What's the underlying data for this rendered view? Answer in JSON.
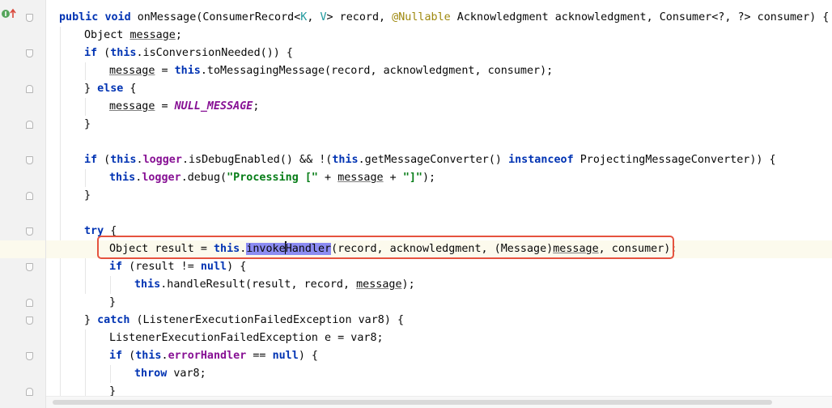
{
  "gutter": {
    "marker_icon": "implements-override-marker-icon"
  },
  "colors": {
    "keyword": "#0033b3",
    "string": "#067d17",
    "constant": "#871094",
    "annotation": "#9e880d",
    "generic": "#20999d",
    "selection": "#8c8cf2",
    "current_line": "#fcfaed",
    "callout_box": "#e5533f"
  },
  "code": {
    "l1": {
      "kw1": "public",
      "kw2": "void",
      "name": " onMessage(ConsumerRecord<",
      "k": "K",
      "comma": ", ",
      "v": "V",
      "rest1": "> record, ",
      "ann": "@Nullable",
      "rest2": " Acknowledgment acknowledgment, Consumer<?, ?> consumer) {"
    },
    "l2": {
      "t1": "Object ",
      "u": "message",
      "t2": ";"
    },
    "l3": {
      "kw": "if",
      "t1": " (",
      "this": "this",
      "t2": ".isConversionNeeded()) {"
    },
    "l4": {
      "u": "message",
      "t1": " = ",
      "this": "this",
      "t2": ".toMessagingMessage(record, acknowledgment, consumer);"
    },
    "l5": {
      "t1": "} ",
      "kw": "else",
      "t2": " {"
    },
    "l6": {
      "u": "message",
      "t1": " = ",
      "c": "NULL_MESSAGE",
      "t2": ";"
    },
    "l7": {
      "t1": "}"
    },
    "l8": {
      "kw": "if",
      "t1": " (",
      "this1": "this",
      "t2": ".",
      "f": "logger",
      "t3": ".isDebugEnabled() && !(",
      "this2": "this",
      "t4": ".getMessageConverter() ",
      "kw2": "instanceof",
      "t5": " ProjectingMessageConverter)) {"
    },
    "l9": {
      "this": "this",
      "t1": ".",
      "f": "logger",
      "t2": ".debug(",
      "s1": "\"Processing [\"",
      "t3": " + ",
      "u": "message",
      "t4": " + ",
      "s2": "\"]\"",
      "t5": ");"
    },
    "l10": {
      "t1": "}"
    },
    "l11": {
      "kw": "try",
      "t1": " {"
    },
    "l12": {
      "t1": "Object result = ",
      "this": "this",
      "t2": ".",
      "sel1": "invoke",
      "sel2": "Handler",
      "t3": "(record, acknowledgment, (Message)",
      "u": "message",
      "t4": ", consumer);"
    },
    "l13": {
      "kw": "if",
      "t1": " (result != ",
      "kw2": "null",
      "t2": ") {"
    },
    "l14": {
      "this": "this",
      "t1": ".handleResult(result, record, ",
      "u": "message",
      "t2": ");"
    },
    "l15": {
      "t1": "}"
    },
    "l16": {
      "t1": "} ",
      "kw": "catch",
      "t2": " (ListenerExecutionFailedException var8) {"
    },
    "l17": {
      "t1": "ListenerExecutionFailedException e = var8;"
    },
    "l18": {
      "kw": "if",
      "t1": " (",
      "this": "this",
      "t2": ".",
      "f": "errorHandler",
      "t3": " == ",
      "kw2": "null",
      "t4": ") {"
    },
    "l19": {
      "kw": "throw",
      "t1": " var8;"
    },
    "l20": {
      "t1": "}"
    }
  }
}
